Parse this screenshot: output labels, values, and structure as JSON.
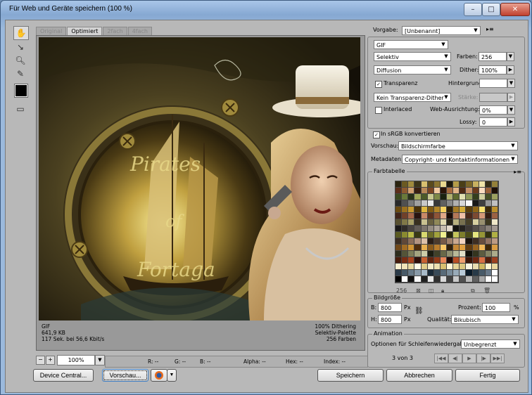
{
  "window": {
    "title": "Für Web und Geräte speichern (100 %)"
  },
  "titlebar_buttons": {
    "minimize": "–",
    "maximize": "□",
    "close": "✕"
  },
  "tools": [
    "hand-tool",
    "slice-select-tool",
    "zoom-tool",
    "eyedropper-tool"
  ],
  "view_tabs": [
    "Original",
    "Optimiert",
    "2fach",
    "4fach"
  ],
  "artwork": {
    "line1": "Pirates",
    "line2": "of",
    "line3": "Fortaga"
  },
  "image_info": {
    "format": "GIF",
    "size": "641,9 KB",
    "time": "117 Sek. bei 56,6 Kbit/s",
    "dither": "100% Dithering",
    "palette": "Selektiv-Palette",
    "colors": "256 Farben"
  },
  "zoom": {
    "value": "100%",
    "minus": "−",
    "plus": "+"
  },
  "readout": {
    "r": "R: --",
    "g": "G: --",
    "b": "B: --",
    "alpha": "Alpha: --",
    "hex": "Hex: --",
    "index": "Index: --"
  },
  "buttons": {
    "device_central": "Device Central...",
    "preview": "Vorschau...",
    "save": "Speichern",
    "cancel": "Abbrechen",
    "done": "Fertig"
  },
  "settings": {
    "preset_label": "Vorgabe:",
    "preset_value": "[Unbenannt]",
    "format": "GIF",
    "reduction": "Selektiv",
    "colors_label": "Farben:",
    "colors_value": "256",
    "dither_algo": "Diffusion",
    "dither_label": "Dither:",
    "dither_value": "100%",
    "transparency_label": "Transparenz",
    "matte_label": "Hintergrund:",
    "trans_dither": "Kein Transparenz-Dither",
    "amount_label": "Stärke:",
    "interlaced_label": "Interlaced",
    "websnap_label": "Web-Ausrichtung:",
    "websnap_value": "0%",
    "lossy_label": "Lossy:",
    "lossy_value": "0",
    "srgb_label": "In sRGB konvertieren",
    "preview_label": "Vorschau:",
    "preview_value": "Bildschirmfarbe",
    "metadata_label": "Metadaten:",
    "metadata_value": "Copyright- und Kontaktinformationen"
  },
  "color_table": {
    "title": "Farbtabelle",
    "count": "256",
    "colors": [
      "#2b2410",
      "#6b5a22",
      "#a08a3c",
      "#3c3418",
      "#d8c070",
      "#5a4a1c",
      "#8a7430",
      "#e8d890",
      "#1e1a0c",
      "#b49c48",
      "#4a3e16",
      "#7a6628",
      "#c8b060",
      "#f0e4a8",
      "#362e14",
      "#94803a",
      "#5c2e1a",
      "#8c5a30",
      "#d0a070",
      "#3a2010",
      "#b88858",
      "#7a4422",
      "#f0c8a0",
      "#2a1408",
      "#a46a40",
      "#e0b488",
      "#4e2a14",
      "#c49068",
      "#6a3a1c",
      "#fadcc0",
      "#986038",
      "#1c0e06",
      "#3c4a20",
      "#6a7a3a",
      "#2a3418",
      "#a0a858",
      "#4c5a28",
      "#c8c890",
      "#7e8848",
      "#1a2210",
      "#b0b070",
      "#5e6a30",
      "#e0e0b0",
      "#8e9858",
      "#343e1c",
      "#d0d0a0",
      "#444e24",
      "#9ca060",
      "#282828",
      "#505050",
      "#787878",
      "#a0a0a0",
      "#c8c8c8",
      "#e8e8e8",
      "#383838",
      "#606060",
      "#888888",
      "#b0b0b0",
      "#d8d8d8",
      "#f8f8f8",
      "#181818",
      "#404040",
      "#989898",
      "#c0c0c0",
      "#6a4a10",
      "#9a7020",
      "#c89a30",
      "#4a3208",
      "#e0b840",
      "#7e5a14",
      "#b08428",
      "#f4d060",
      "#2e2006",
      "#a47a24",
      "#d4ac38",
      "#5a3e0c",
      "#8c6418",
      "#f8e070",
      "#3c2a08",
      "#bc902c",
      "#402418",
      "#70402a",
      "#a8684a",
      "#281410",
      "#c88868",
      "#58301e",
      "#8e5438",
      "#e0a888",
      "#180a06",
      "#b47858",
      "#f0c0a8",
      "#4a281a",
      "#7c4a32",
      "#d49878",
      "#341c12",
      "#9c6244",
      "#585030",
      "#807848",
      "#a8a068",
      "#383020",
      "#c8c090",
      "#686040",
      "#908858",
      "#e0d8b0",
      "#282418",
      "#b8b080",
      "#787050",
      "#484028",
      "#d8d0a0",
      "#989070",
      "#3c3820",
      "#f0e8c8",
      "#1a1818",
      "#302c28",
      "#4a4440",
      "#625c56",
      "#7c746c",
      "#958c82",
      "#aea49a",
      "#c8beb2",
      "#e2d8cc",
      "#141210",
      "#26221e",
      "#3e3834",
      "#56504a",
      "#6e6660",
      "#888078",
      "#a29890",
      "#5a5a20",
      "#8a8a30",
      "#baba48",
      "#3a3a14",
      "#d8d870",
      "#6e6e28",
      "#a2a23c",
      "#f0f090",
      "#26260c",
      "#c6c65c",
      "#7e7e2c",
      "#4c4c18",
      "#e6e680",
      "#969636",
      "#32320e",
      "#b0b044",
      "#3a2c20",
      "#604838",
      "#8a6c58",
      "#b49480",
      "#dcc0a8",
      "#2a1e16",
      "#4c3a2c",
      "#765a48",
      "#a08068",
      "#caa890",
      "#f2d4c0",
      "#1a120c",
      "#3e2e22",
      "#684e3e",
      "#927260",
      "#bc9a84",
      "#704818",
      "#a06c24",
      "#d09434",
      "#502e0c",
      "#e8b050",
      "#885a1c",
      "#b87c2c",
      "#f8c868",
      "#30200a",
      "#c48838",
      "#e0a040",
      "#603c10",
      "#986420",
      "#f0b858",
      "#402808",
      "#d89c44",
      "#2c2c1c",
      "#545438",
      "#7c7c58",
      "#a4a480",
      "#cccca8",
      "#1c1c10",
      "#404028",
      "#686848",
      "#909070",
      "#b8b898",
      "#e0e0c8",
      "#101008",
      "#34341e",
      "#5c5c40",
      "#848464",
      "#acac8c",
      "#481c0c",
      "#782e14",
      "#a8441e",
      "#30100a",
      "#c86030",
      "#602410",
      "#903a18",
      "#e8885a",
      "#200804",
      "#b84e24",
      "#f0a070",
      "#3c1608",
      "#6c2812",
      "#d87044",
      "#541e0c",
      "#9c4020",
      "#f8f0d0",
      "#f0e4b8",
      "#e8d8a0",
      "#fffce8",
      "#e0cc88",
      "#f4ecc8",
      "#ece0b0",
      "#d8c070",
      "#fff8d8",
      "#e4d498",
      "#dcc880",
      "#f8f4e0",
      "#e8dcb0",
      "#d0b860",
      "#fcf4d0",
      "#ead8a0",
      "#2a3a48",
      "#485a68",
      "#687a88",
      "#889aa8",
      "#a8bac8",
      "#1a2a38",
      "#384a58",
      "#586a78",
      "#788a98",
      "#98aab8",
      "#b8cad8",
      "#0a1a28",
      "#283a48",
      "#485a68",
      "#687888",
      "#ffffff",
      "#000000",
      "#ffffff",
      "#101010",
      "#f8f8f8",
      "#202020",
      "#e8e8e8",
      "#303030",
      "#d8d8d8",
      "#404040",
      "#c8c8c8",
      "#505050",
      "#b8b8b8",
      "#606060",
      "#a8a8a8",
      "#ffffff",
      "#ffffff"
    ]
  },
  "image_size": {
    "title": "Bildgröße",
    "w_label": "B:",
    "w_value": "800",
    "h_label": "H:",
    "h_value": "800",
    "unit": "Px",
    "percent_label": "Prozent:",
    "percent_value": "100",
    "percent_unit": "%",
    "quality_label": "Qualität:",
    "quality_value": "Bikubisch"
  },
  "animation": {
    "title": "Animation",
    "loop_label": "Optionen für Schleifenwiedergabe:",
    "loop_value": "Unbegrenzt",
    "frame_counter": "3 von 3"
  }
}
